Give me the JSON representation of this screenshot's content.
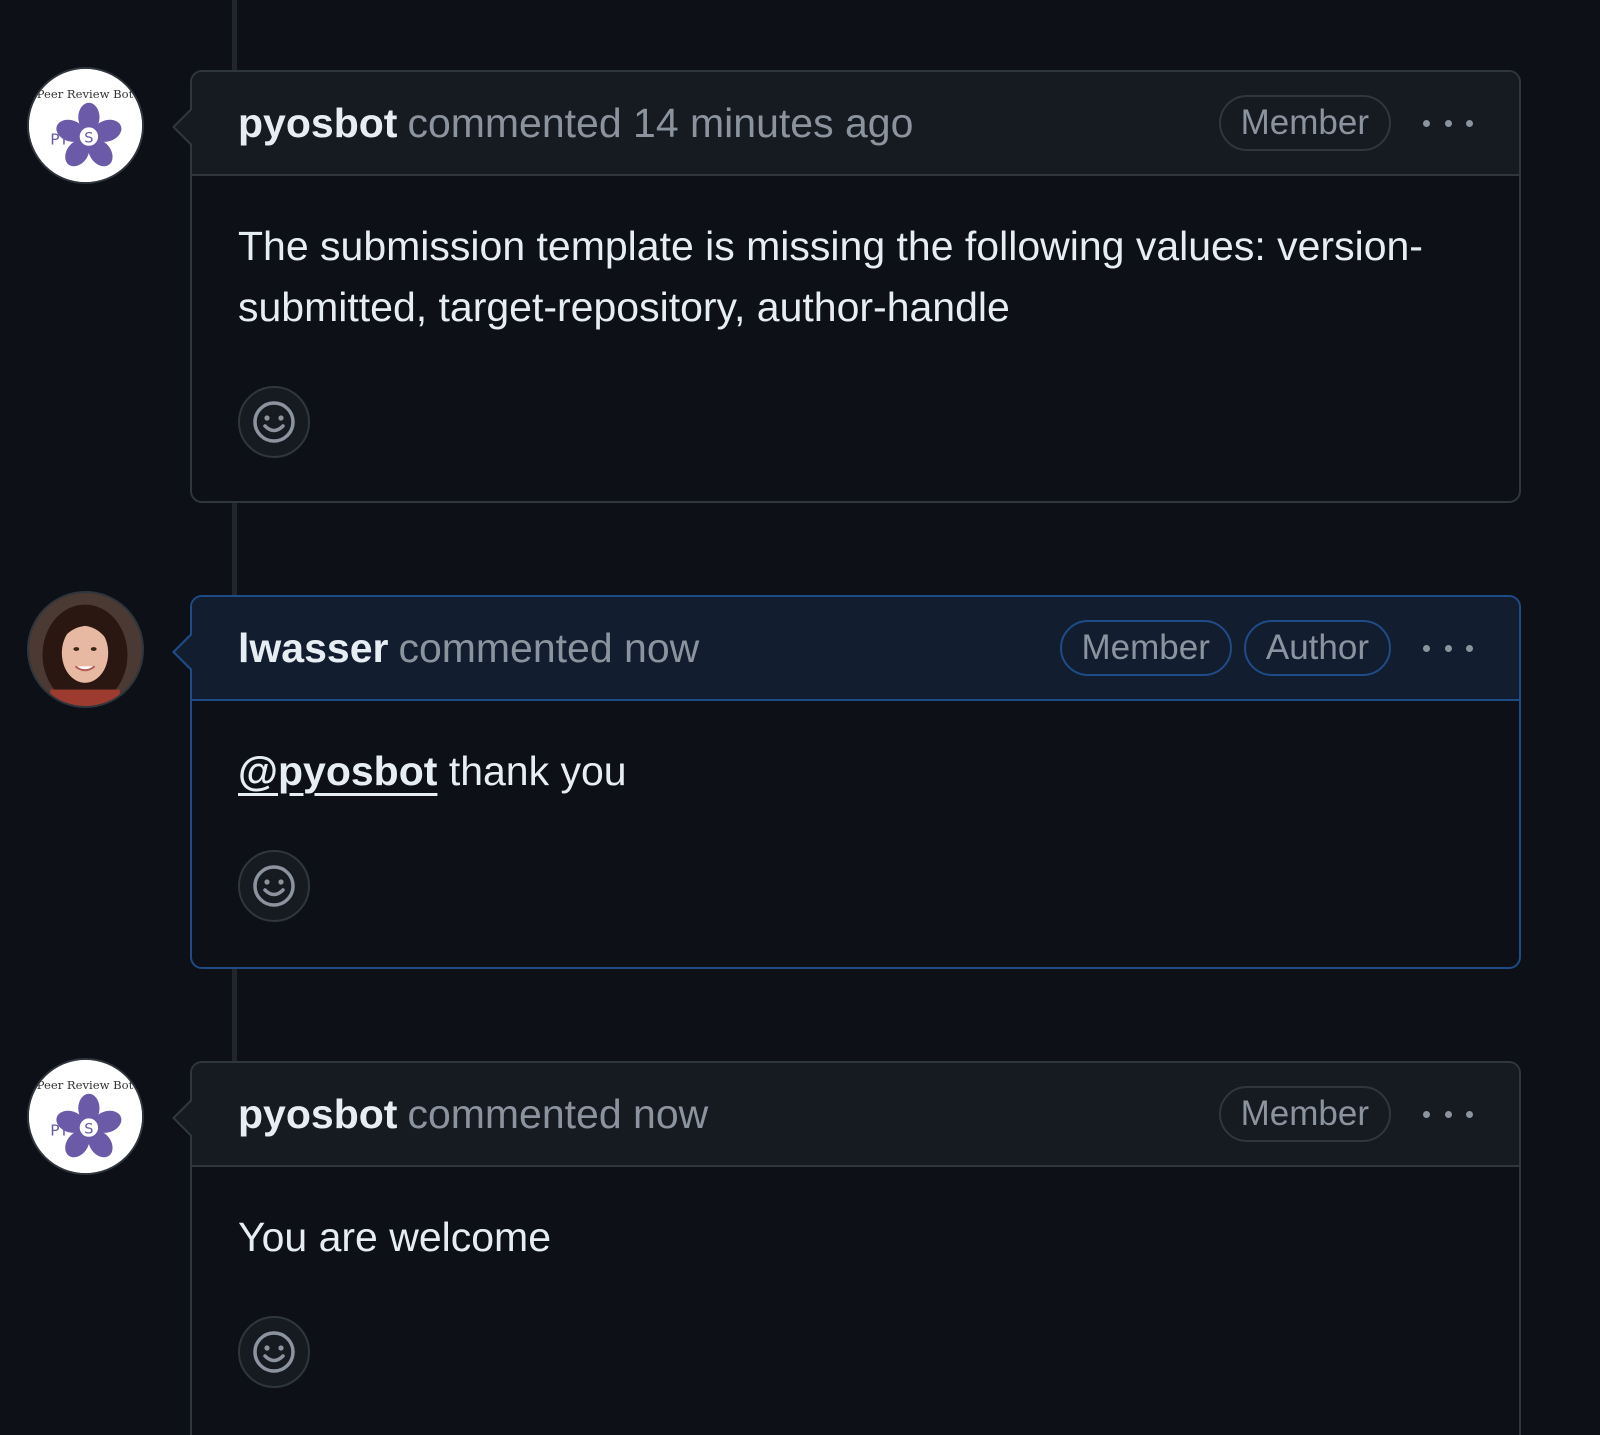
{
  "comments": [
    {
      "username": "pyosbot",
      "meta": "commented 14 minutes ago",
      "badges": [
        "Member"
      ],
      "avatar": "pyos-bot-logo",
      "avatar_text": {
        "top": "Peer Review Bot",
        "left": "PY"
      },
      "body": "The submission template is missing the following values: version-submitted, target-repository, author-handle"
    },
    {
      "username": "lwasser",
      "meta": "commented now",
      "badges": [
        "Member",
        "Author"
      ],
      "avatar": "user-photo",
      "mention": "@pyosbot",
      "body": " thank you"
    },
    {
      "username": "pyosbot",
      "meta": "commented now",
      "badges": [
        "Member"
      ],
      "avatar": "pyos-bot-logo",
      "avatar_text": {
        "top": "Peer Review Bot",
        "left": "PY"
      },
      "body": "You are welcome"
    }
  ],
  "icons": {
    "reaction": "smiley-icon",
    "menu": "kebab-horizontal-icon"
  },
  "colors": {
    "background": "#0d1117",
    "header": "#161b22",
    "border": "#30363d",
    "author_border": "#1f4b86",
    "muted_text": "#8b949e",
    "text": "#e6edf3",
    "logo_purple": "#6a5aa8"
  }
}
